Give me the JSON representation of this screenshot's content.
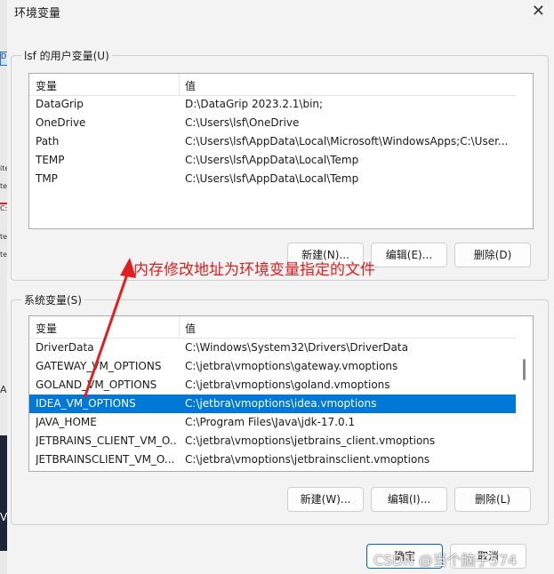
{
  "window": {
    "title": "环境变量",
    "close_glyph": "✕"
  },
  "background": {
    "fragments": [
      "D",
      "ite",
      "te",
      "C:",
      "te",
      "te",
      "A",
      "V"
    ]
  },
  "user_vars": {
    "group_label": "lsf 的用户变量(U)",
    "header": {
      "name": "变量",
      "value": "值"
    },
    "rows": [
      {
        "name": "DataGrip",
        "value": "D:\\DataGrip 2023.2.1\\bin;"
      },
      {
        "name": "OneDrive",
        "value": "C:\\Users\\lsf\\OneDrive"
      },
      {
        "name": "Path",
        "value": "C:\\Users\\lsf\\AppData\\Local\\Microsoft\\WindowsApps;C:\\User..."
      },
      {
        "name": "TEMP",
        "value": "C:\\Users\\lsf\\AppData\\Local\\Temp"
      },
      {
        "name": "TMP",
        "value": "C:\\Users\\lsf\\AppData\\Local\\Temp"
      }
    ],
    "buttons": {
      "new": "新建(N)...",
      "edit": "编辑(E)...",
      "delete": "删除(D)"
    }
  },
  "annotation": {
    "text": "内存修改地址为环境变量指定的文件",
    "color": "#e02020"
  },
  "system_vars": {
    "group_label": "系统变量(S)",
    "header": {
      "name": "变量",
      "value": "值"
    },
    "rows": [
      {
        "name": "DriverData",
        "value": "C:\\Windows\\System32\\Drivers\\DriverData"
      },
      {
        "name": "GATEWAY_VM_OPTIONS",
        "value": "C:\\jetbra\\vmoptions\\gateway.vmoptions"
      },
      {
        "name": "GOLAND_VM_OPTIONS",
        "value": "C:\\jetbra\\vmoptions\\goland.vmoptions"
      },
      {
        "name": "IDEA_VM_OPTIONS",
        "value": "C:\\jetbra\\vmoptions\\idea.vmoptions"
      },
      {
        "name": "JAVA_HOME",
        "value": "C:\\Program Files\\Java\\jdk-17.0.1"
      },
      {
        "name": "JETBRAINS_CLIENT_VM_O...",
        "value": "C:\\jetbra\\vmoptions\\jetbrains_client.vmoptions"
      },
      {
        "name": "JETBRAINSCLIENT_VM_O...",
        "value": "C:\\jetbra\\vmoptions\\jetbrainsclient.vmoptions"
      }
    ],
    "selected_index": 3,
    "buttons": {
      "new": "新建(W)...",
      "edit": "编辑(I)...",
      "delete": "删除(L)"
    }
  },
  "footer": {
    "ok": "确定",
    "cancel": "取消"
  },
  "watermark": "CSDN @当个脑子574",
  "colors": {
    "selection": "#0078d7",
    "annotation": "#e02020",
    "primary_border": "#0067c0"
  }
}
